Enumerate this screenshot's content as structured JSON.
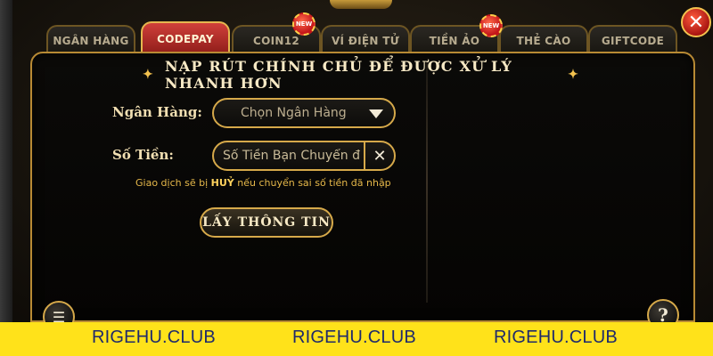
{
  "tabs": [
    {
      "label": "NGÂN HÀNG",
      "active": false,
      "is_new": false
    },
    {
      "label": "CODEPAY",
      "active": true,
      "is_new": false
    },
    {
      "label": "COIN12",
      "active": false,
      "is_new": true
    },
    {
      "label": "VÍ ĐIỆN TỬ",
      "active": false,
      "is_new": false
    },
    {
      "label": "TIỀN ẢO",
      "active": false,
      "is_new": true
    },
    {
      "label": "THẺ CÀO",
      "active": false,
      "is_new": false
    },
    {
      "label": "GIFTCODE",
      "active": false,
      "is_new": false
    }
  ],
  "badge_label": "NEW",
  "close_icon": "close-icon",
  "panel": {
    "title": "NẠP RÚT CHÍNH CHỦ ĐỂ ĐƯỢC XỬ LÝ NHANH HƠN",
    "bank_label": "Ngân Hàng:",
    "bank_select_value": "Chọn Ngân Hàng",
    "amount_label": "Số Tiền:",
    "amount_placeholder": "Số Tiền Bạn Chuyển đ",
    "warning_prefix": "Giao dịch sẽ bị ",
    "warning_emphasis": "HUỶ",
    "warning_suffix": " nếu chuyển sai số tiền đã nhập",
    "action_button": "LẤY THÔNG TIN",
    "help_label": "?"
  },
  "watermark": [
    "RIGEHU.CLUB",
    "RIGEHU.CLUB",
    "RIGEHU.CLUB"
  ],
  "colors": {
    "active_tab": "#c62f2a",
    "gold_border": "#d6a94a",
    "watermark_bg": "#ffe21a",
    "watermark_text": "#1f2a6b"
  }
}
